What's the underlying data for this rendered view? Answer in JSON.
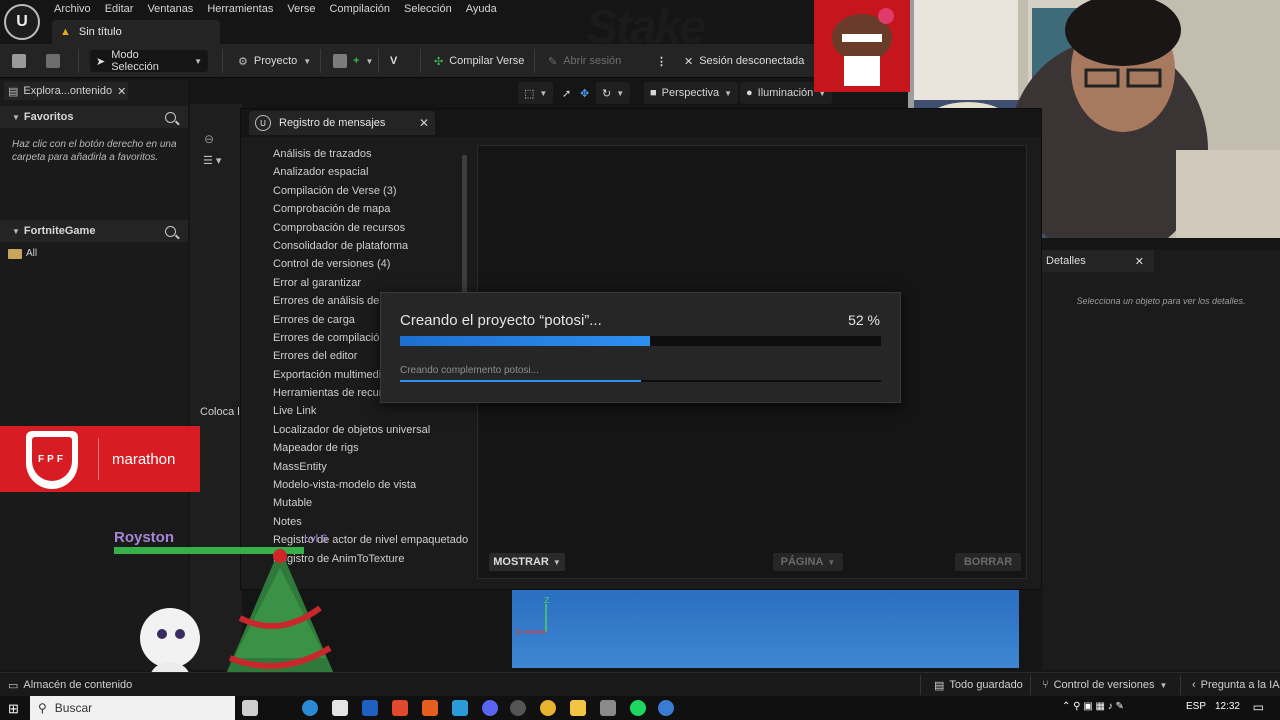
{
  "menu": [
    "Archivo",
    "Editar",
    "Ventanas",
    "Herramientas",
    "Verse",
    "Compilación",
    "Selección",
    "Ayuda"
  ],
  "doc_tab": {
    "title": "Sin título"
  },
  "toolbar": {
    "mode": "Modo Selección",
    "project": "Proyecto",
    "compile": "Compilar Verse",
    "login": "Abrir sesión",
    "session": "Sesión desconectada"
  },
  "viewport_toolbar": {
    "perspective": "Perspectiva",
    "lighting": "Iluminación"
  },
  "left": {
    "tab": "Explora...ontenido",
    "favorites_title": "Favoritos",
    "favorites_hint": "Haz clic con el botón derecho en una carpeta para añadirla a favoritos.",
    "project_title": "FortniteGame",
    "folder": "All"
  },
  "middle": {
    "coloca": "Coloca l"
  },
  "message_log": {
    "title": "Registro de mensajes",
    "categories": [
      "Análisis de trazados",
      "Analizador espacial",
      "Compilación de Verse (3)",
      "Comprobación de mapa",
      "Comprobación de recursos",
      "Consolidador de plataforma",
      "Control de versiones (4)",
      "Error al garantizar",
      "Errores de análisis de U",
      "Errores de carga",
      "Errores de compilación",
      "Errores del editor",
      "Exportación multimedia",
      "Herramientas de recurs",
      "Live Link",
      "Localizador de objetos universal",
      "Mapeador de rigs",
      "MassEntity",
      "Modelo-vista-modelo de vista",
      "Mutable",
      "Notes",
      "Registro de actor de nivel empaquetado",
      "Registro de AnimToTexture"
    ],
    "show": "MOSTRAR",
    "page": "PÁGINA",
    "clear": "BORRAR"
  },
  "progress": {
    "title": "Creando el proyecto “potosi”...",
    "percent_label": "52 %",
    "percent": 52,
    "subtitle": "Creando complemento potosi...",
    "sub_percent": 50
  },
  "details": {
    "title": "Detalles",
    "hint": "Selecciona un objeto para ver los detalles."
  },
  "statusbar": {
    "content": "Almacén de contenido",
    "saved": "Todo guardado",
    "version_control": "Control de versiones",
    "ask_ai": "Pregunta a la IA"
  },
  "overlays": {
    "watermark": "Stake",
    "banner_badge": "FPF",
    "banner_text": "marathon",
    "player": "Royston",
    "level": "Lvl 6"
  },
  "taskbar": {
    "search": "Buscar",
    "language": "ESP",
    "time": "12:32"
  },
  "colors": {
    "accent": "#2d8ff0",
    "banner": "#d81c23",
    "viewport": "#3e86d2",
    "warning": "#e3a81c"
  }
}
